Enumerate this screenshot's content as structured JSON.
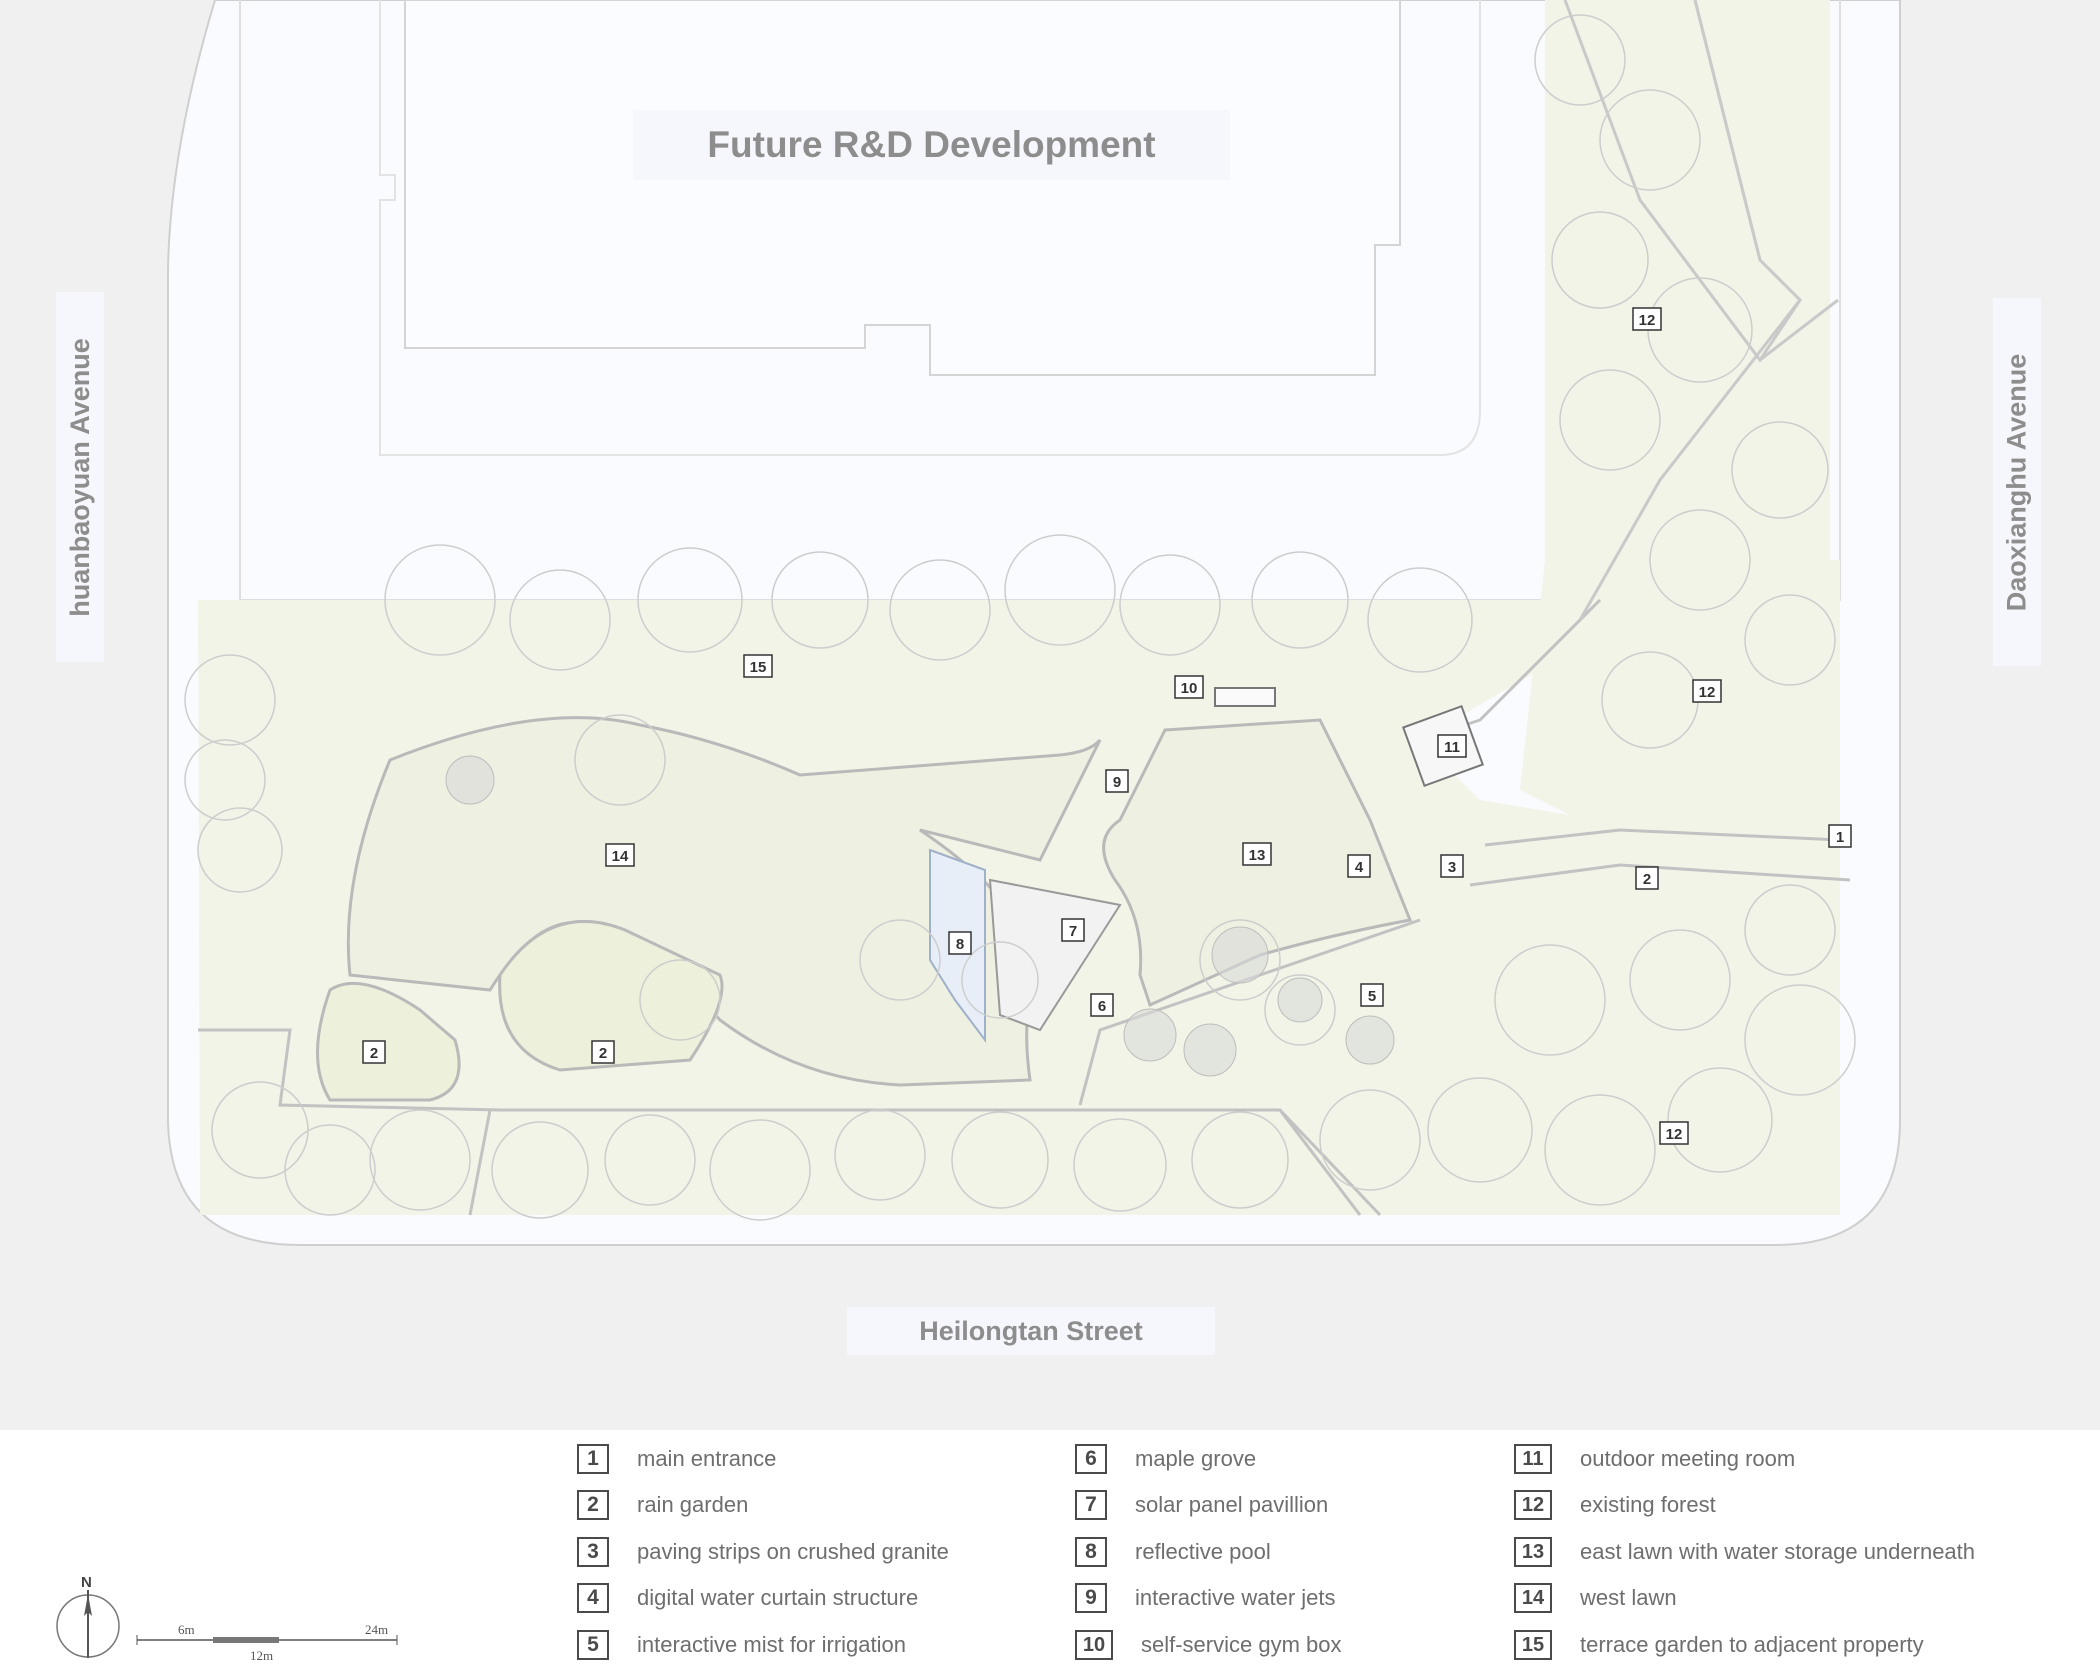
{
  "title": "Future R&D Development",
  "streets": {
    "west": "huanbaoyuan Avenue",
    "east": "Daoxianghu Avenue",
    "south": "Heilongtan Street"
  },
  "plan_markers": [
    {
      "num": "1",
      "area": "main entrance"
    },
    {
      "num": "2",
      "area": "rain garden"
    },
    {
      "num": "2",
      "area": "rain garden"
    },
    {
      "num": "2",
      "area": "rain garden"
    },
    {
      "num": "3",
      "area": "paving strips on crushed granite"
    },
    {
      "num": "4",
      "area": "digital water curtain structure"
    },
    {
      "num": "5",
      "area": "interactive mist for irrigation"
    },
    {
      "num": "6",
      "area": "maple grove"
    },
    {
      "num": "7",
      "area": "solar panel pavillion"
    },
    {
      "num": "8",
      "area": "reflective pool"
    },
    {
      "num": "9",
      "area": "interactive water jets"
    },
    {
      "num": "10",
      "area": "self-service gym box"
    },
    {
      "num": "11",
      "area": "outdoor meeting room"
    },
    {
      "num": "12",
      "area": "existing forest"
    },
    {
      "num": "12",
      "area": "existing forest"
    },
    {
      "num": "12",
      "area": "existing forest"
    },
    {
      "num": "13",
      "area": "east lawn with water storage underneath"
    },
    {
      "num": "14",
      "area": "west lawn"
    },
    {
      "num": "15",
      "area": "terrace garden to adjacent property"
    }
  ],
  "legend": [
    {
      "num": "1",
      "label": "main entrance"
    },
    {
      "num": "2",
      "label": "rain garden"
    },
    {
      "num": "3",
      "label": "paving strips on crushed granite"
    },
    {
      "num": "4",
      "label": "digital water curtain structure"
    },
    {
      "num": "5",
      "label": "interactive mist for irrigation"
    },
    {
      "num": "6",
      "label": "maple grove"
    },
    {
      "num": "7",
      "label": "solar panel pavillion"
    },
    {
      "num": "8",
      "label": "reflective pool"
    },
    {
      "num": "9",
      "label": "interactive water jets"
    },
    {
      "num": "10",
      "label": "self-service gym box"
    },
    {
      "num": "11",
      "label": "outdoor meeting room"
    },
    {
      "num": "12",
      "label": "existing forest"
    },
    {
      "num": "13",
      "label": "east lawn with water storage underneath"
    },
    {
      "num": "14",
      "label": "west lawn"
    },
    {
      "num": "15",
      "label": "terrace garden to adjacent property"
    }
  ],
  "north_arrow": {
    "label": "N",
    "icon": "north-arrow-icon"
  },
  "scale_bar": {
    "tick_6": "6m",
    "tick_12": "12m",
    "tick_24": "24m"
  },
  "colors": {
    "street": "#f0f0f0",
    "site": "#fafbff",
    "lawn": "#f1f4e7",
    "outline": "#b9b9b9",
    "label_box": "#f4f6fb",
    "label_text": "#8d8d8d",
    "water": "#e8eef8"
  }
}
